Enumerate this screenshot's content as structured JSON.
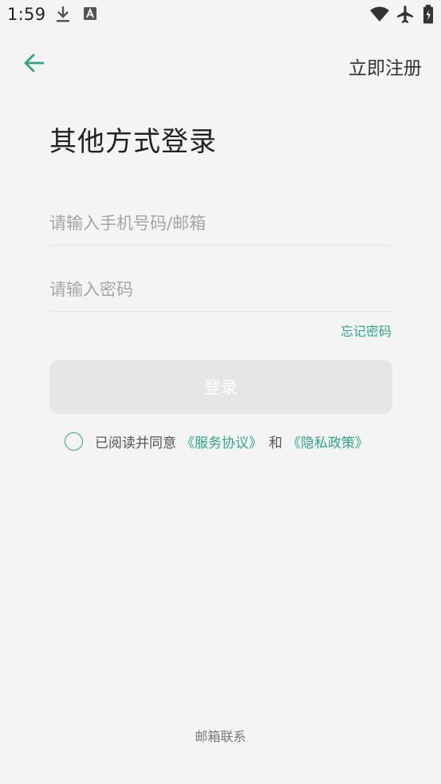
{
  "status_bar": {
    "time": "1:59",
    "icons": [
      "download-icon",
      "a-badge-icon",
      "wifi-icon",
      "airplane-icon",
      "battery-icon"
    ]
  },
  "header": {
    "register_label": "立即注册"
  },
  "title": "其他方式登录",
  "form": {
    "account_placeholder": "请输入手机号码/邮箱",
    "account_value": "",
    "password_placeholder": "请输入密码",
    "password_value": "",
    "forgot_label": "忘记密码",
    "login_label": "登录"
  },
  "agreement": {
    "prefix": "已阅读并同意",
    "service_link": "《服务协议》",
    "and": "和",
    "privacy_link": "《隐私政策》",
    "checked": false
  },
  "footer": {
    "contact_label": "邮箱联系"
  },
  "colors": {
    "accent": "#2ea789",
    "background": "#f4f4f4",
    "button_disabled": "#e6e6e6"
  }
}
